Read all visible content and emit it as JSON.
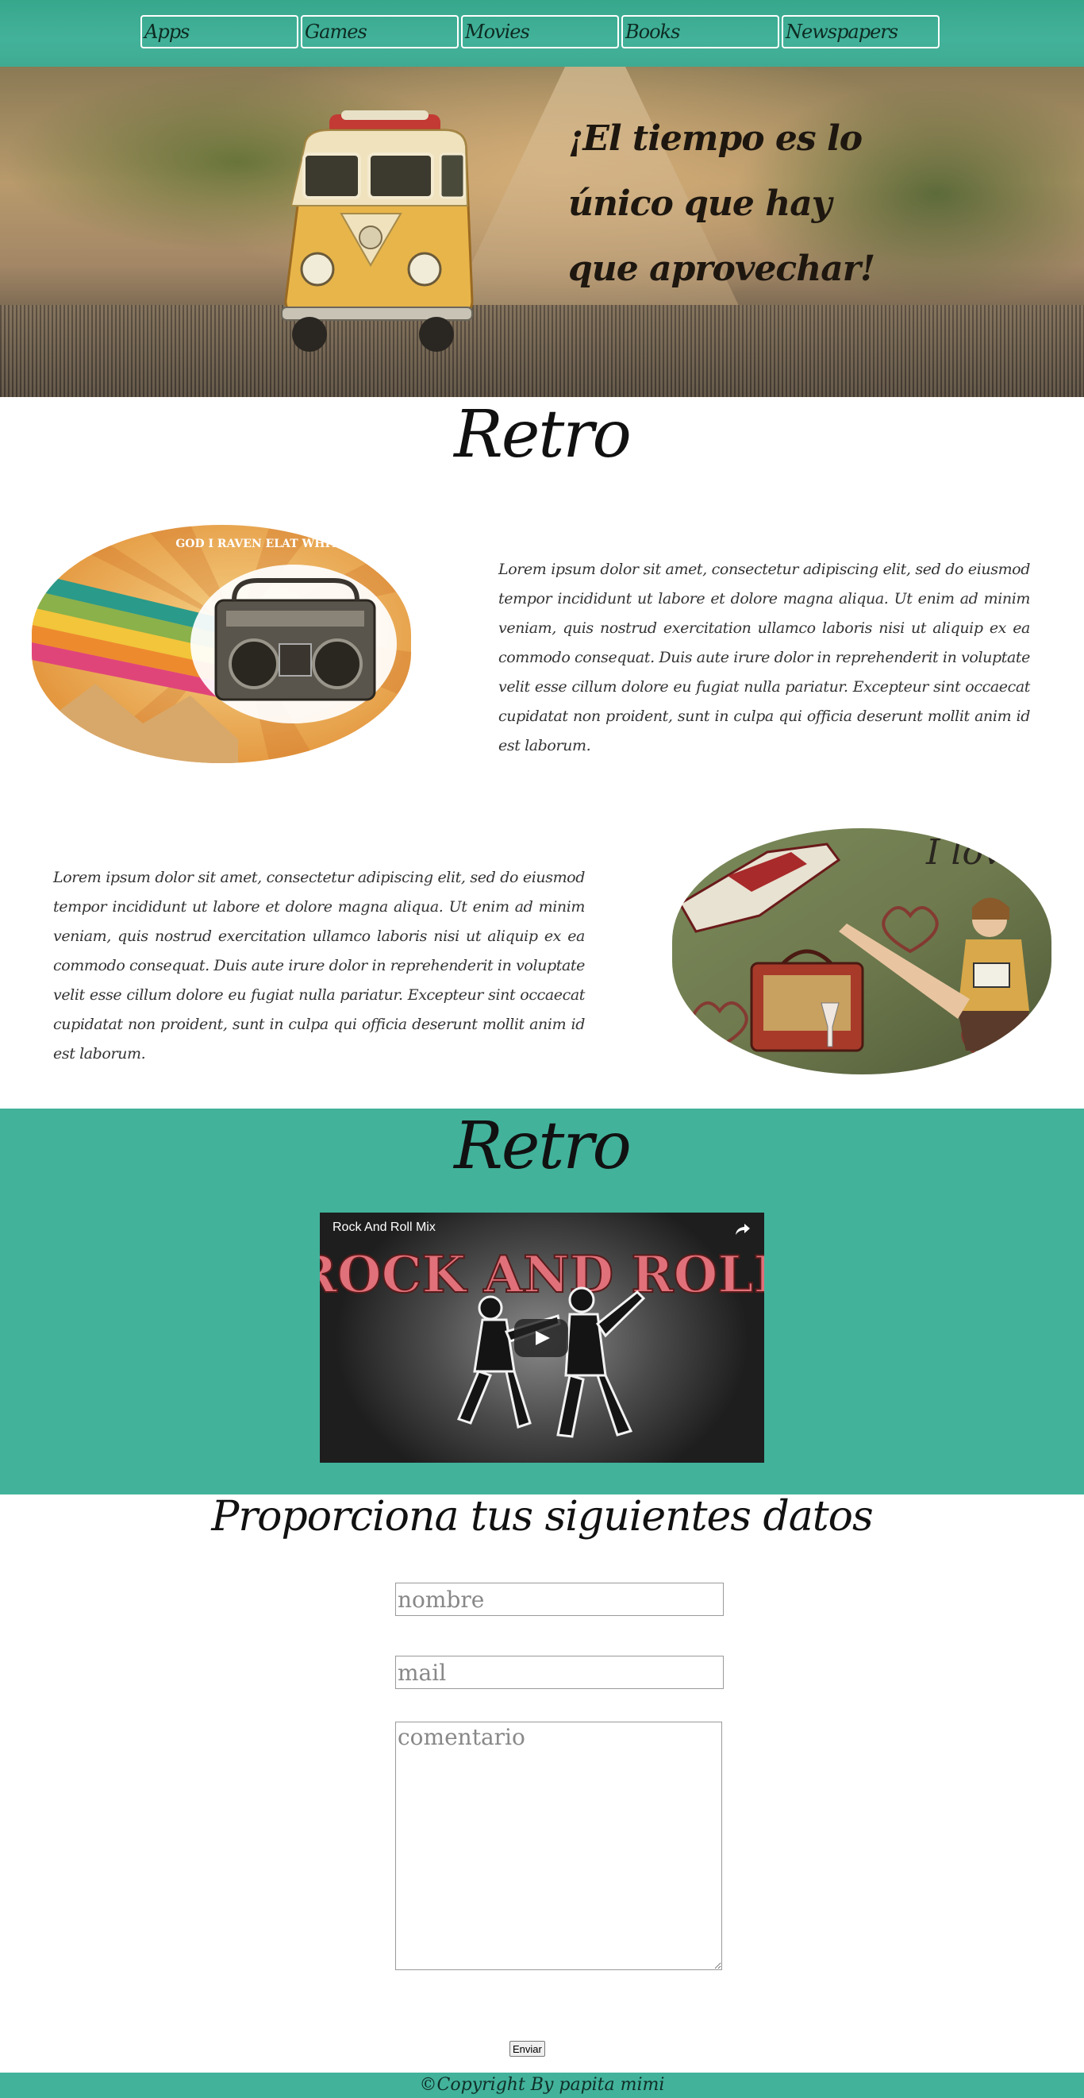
{
  "nav": {
    "items": [
      "Apps",
      "Games",
      "Movies",
      "Books",
      "Newspapers"
    ]
  },
  "hero": {
    "quote": "¡El tiempo es lo único que hay que aprovechar!"
  },
  "section1": {
    "title": "Retro",
    "paragraph1": "Lorem ipsum dolor sit amet, consectetur adipiscing elit, sed do eiusmod tempor incididunt ut labore et dolore magna aliqua. Ut enim ad minim veniam, quis nostrud exercitation ullamco laboris nisi ut aliquip ex ea commodo consequat. Duis aute irure dolor in reprehenderit in voluptate velit esse cillum dolore eu fugiat nulla pariatur. Excepteur sint occaecat cupidatat non proident, sunt in culpa qui officia deserunt mollit anim id est laborum.",
    "paragraph2": "Lorem ipsum dolor sit amet, consectetur adipiscing elit, sed do eiusmod tempor incididunt ut labore et dolore magna aliqua. Ut enim ad minim veniam, quis nostrud exercitation ullamco laboris nisi ut aliquip ex ea commodo consequat. Duis aute irure dolor in reprehenderit in voluptate velit esse cillum dolore eu fugiat nulla pariatur. Excepteur sint occaecat cupidatat non proident, sunt in culpa qui officia deserunt mollit anim id est laborum.",
    "poster_text": "GOD I RAVEN ELAT WHITE AS SNOW",
    "love_text": "I love you"
  },
  "video_section": {
    "title": "Retro",
    "video_title": "Rock And Roll Mix",
    "video_art_text": "ROCK AND ROLL"
  },
  "form": {
    "title": "Proporciona tus siguientes datos",
    "name_placeholder": "nombre",
    "mail_placeholder": "mail",
    "comment_placeholder": "comentario",
    "submit_label": "Enviar"
  },
  "footer": {
    "text": "©Copyright By papita mimi"
  },
  "colors": {
    "accent": "#42b29b",
    "nav_border": "#ffffff"
  }
}
